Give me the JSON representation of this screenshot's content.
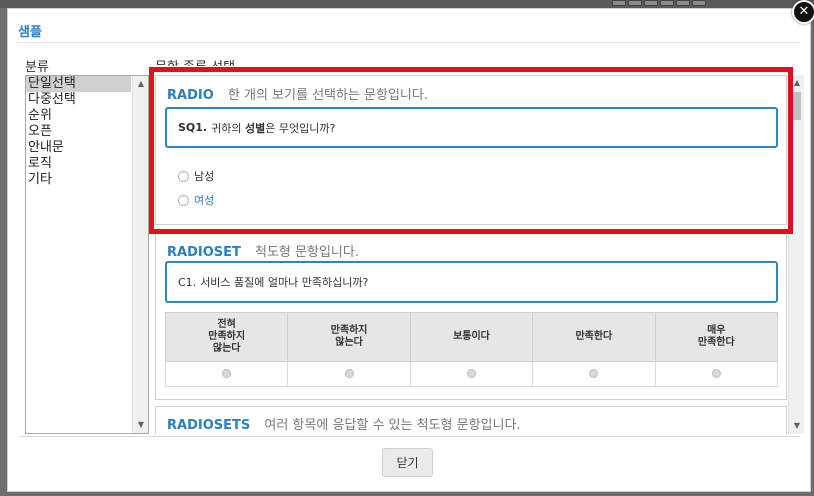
{
  "dialog": {
    "title": "샘플",
    "close_icon": "✕",
    "category_label": "분류",
    "type_label": "문항 종류 선택",
    "close_button_label": "닫기"
  },
  "categories": [
    {
      "label": "단일선택",
      "selected": true
    },
    {
      "label": "다중선택"
    },
    {
      "label": "순위"
    },
    {
      "label": "오픈"
    },
    {
      "label": "안내문"
    },
    {
      "label": "로직"
    },
    {
      "label": "기타"
    }
  ],
  "samples": {
    "radio": {
      "name": "RADIO",
      "description": "한 개의 보기를 선택하는 문항입니다.",
      "question_no": "SQ1.",
      "question_pre": "귀하의",
      "question_bold": "성별",
      "question_post": "은 무엇입니까?",
      "options": [
        "남성",
        "여성"
      ]
    },
    "radioset": {
      "name": "RADIOSET",
      "description": "척도형 문항입니다.",
      "question_no": "C1.",
      "question": "서비스 품질에 얼마나 만족하십니까?",
      "scale": [
        "전혀\n만족하지\n않는다",
        "만족하지\n않는다",
        "보통이다",
        "만족한다",
        "매우\n만족한다"
      ]
    },
    "radiosets": {
      "name": "RADIOSETS",
      "description": "여러 항목에 응답할 수 있는 척도형 문항입니다."
    }
  },
  "colors": {
    "accent": "#2a7fc0",
    "highlight": "#e0101e",
    "question_border": "#2e86c1"
  },
  "icons": {
    "scroll_up": "▲",
    "scroll_down": "▼"
  }
}
